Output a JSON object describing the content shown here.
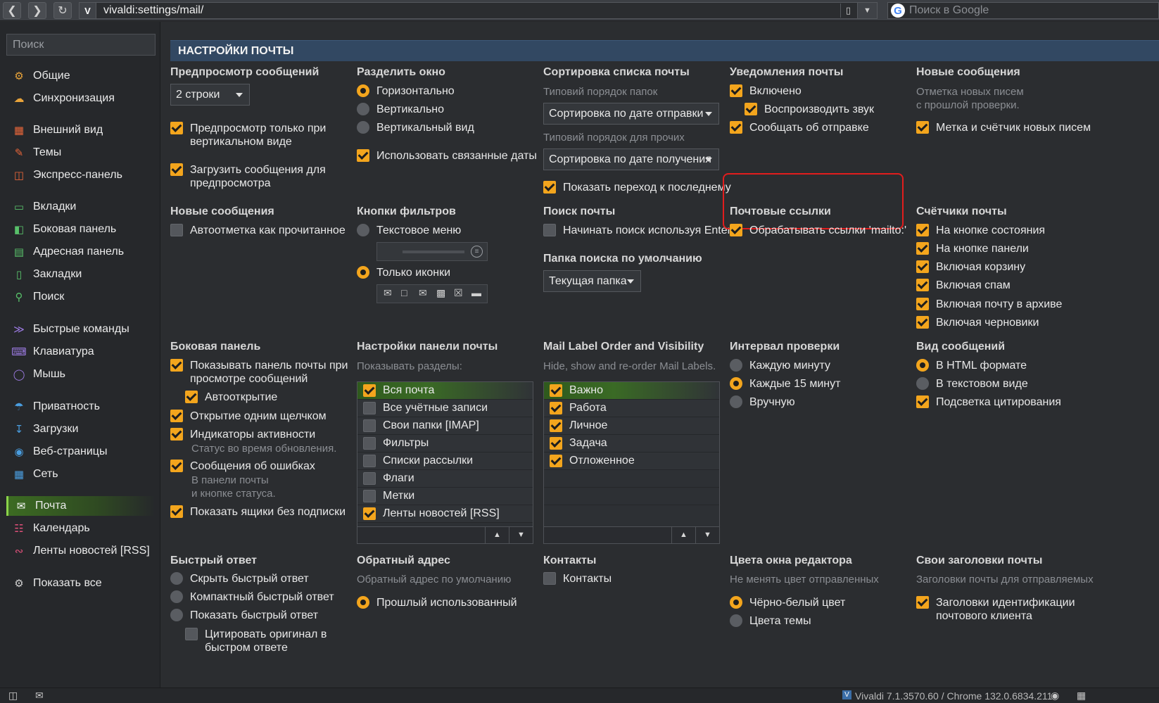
{
  "browser": {
    "url": "vivaldi:settings/mail/",
    "search_placeholder": "Поиск в Google",
    "vivaldi_logo": "V",
    "google_logo": "G"
  },
  "sidebar": {
    "search_placeholder": "Поиск",
    "items": [
      {
        "label": "Общие",
        "icon": "gear-cog-icon"
      },
      {
        "label": "Синхронизация",
        "icon": "cloud-icon"
      },
      {
        "label": "Внешний вид",
        "icon": "appearance-icon"
      },
      {
        "label": "Темы",
        "icon": "brush-icon"
      },
      {
        "label": "Экспресс-панель",
        "icon": "speed-dial-icon"
      },
      {
        "label": "Вкладки",
        "icon": "tabs-icon"
      },
      {
        "label": "Боковая панель",
        "icon": "panel-icon"
      },
      {
        "label": "Адресная панель",
        "icon": "address-bar-icon"
      },
      {
        "label": "Закладки",
        "icon": "bookmark-icon"
      },
      {
        "label": "Поиск",
        "icon": "search-icon"
      },
      {
        "label": "Быстрые команды",
        "icon": "quick-commands-icon"
      },
      {
        "label": "Клавиатура",
        "icon": "keyboard-icon"
      },
      {
        "label": "Мышь",
        "icon": "mouse-icon"
      },
      {
        "label": "Приватность",
        "icon": "shield-icon"
      },
      {
        "label": "Загрузки",
        "icon": "download-icon"
      },
      {
        "label": "Веб-страницы",
        "icon": "globe-icon"
      },
      {
        "label": "Сеть",
        "icon": "network-icon"
      },
      {
        "label": "Почта",
        "icon": "mail-icon",
        "active": true
      },
      {
        "label": "Календарь",
        "icon": "calendar-icon"
      },
      {
        "label": "Ленты новостей [RSS]",
        "icon": "rss-icon"
      },
      {
        "label": "Показать все",
        "icon": "gear-icon"
      }
    ]
  },
  "header": "НАСТРОЙКИ ПОЧТЫ",
  "preview": {
    "title": "Предпросмотр сообщений",
    "dropdown": "2 строки",
    "opt1": [
      "Предпросмотр только при",
      "вертикальном виде"
    ],
    "opt2": [
      "Загрузить сообщения для",
      "предпросмотра"
    ]
  },
  "split": {
    "title": "Разделить окно",
    "r1": "Горизонтально",
    "r2": "Вертикально",
    "r3": "Вертикальный вид",
    "c1": "Использовать связанные даты"
  },
  "sorting": {
    "title": "Сортировка списка почты",
    "sub1": "Типовий порядок папок",
    "dd1": "Сортировка по дате отправки",
    "sub2": "Типовий порядок для прочих",
    "dd2": "Сортировка по дате получения",
    "c1": "Показать переход к последнему"
  },
  "notify": {
    "title": "Уведомления почты",
    "c1": "Включено",
    "c2": "Воспроизводить звук",
    "c3": "Сообщать об отправке"
  },
  "newmsg": {
    "title": "Новые сообщения",
    "sub": [
      "Отметка новых писем",
      "с прошлой проверки."
    ],
    "c1": "Метка и счётчик новых писем"
  },
  "newmsg2": {
    "title": "Новые сообщения",
    "c1": "Автоотметка как прочитанное"
  },
  "filters": {
    "title": "Кнопки фильтров",
    "r1": "Текстовое меню",
    "r2": "Только иконки"
  },
  "mailsearch": {
    "title": "Поиск почты",
    "c1": "Начинать поиск используя Enter",
    "title2": "Папка поиска по умолчанию",
    "dd": "Текущая папка"
  },
  "links": {
    "title": "Почтовые ссылки",
    "c1": "Обрабатывать ссылки 'mailto:'"
  },
  "counters": {
    "title": "Счётчики почты",
    "items": [
      "На кнопке состояния",
      "На кнопке панели",
      "Включая корзину",
      "Включая спам",
      "Включая почту в архиве",
      "Включая черновики"
    ]
  },
  "sidepanel": {
    "title": "Боковая панель",
    "c1": [
      "Показывать панель почты при",
      "просмотре сообщений"
    ],
    "c2": "Автооткрытие",
    "c3": "Открытие одним щелчком",
    "c4": "Индикаторы активности",
    "c4sub": "Статус во время обновления.",
    "c5": "Сообщения об ошибках",
    "c5sub": [
      "В панели почты",
      "и кнопке статуса."
    ],
    "c6": "Показать ящики без подписки"
  },
  "panelset": {
    "title": "Настройки панели почты",
    "sub": "Показывать разделы:",
    "rows": [
      {
        "label": "Вся почта",
        "on": true
      },
      {
        "label": "Все учётные записи",
        "on": false
      },
      {
        "label": "Свои папки [IMAP]",
        "on": false
      },
      {
        "label": "Фильтры",
        "on": false
      },
      {
        "label": "Списки рассылки",
        "on": false
      },
      {
        "label": "Флаги",
        "on": false
      },
      {
        "label": "Метки",
        "on": false
      },
      {
        "label": "Ленты новостей [RSS]",
        "on": true
      }
    ]
  },
  "labels": {
    "title": "Mail Label Order and Visibility",
    "sub": "Hide, show and re-order Mail Labels.",
    "rows": [
      "Важно",
      "Работа",
      "Личное",
      "Задача",
      "Отложенное"
    ]
  },
  "interval": {
    "title": "Интервал проверки",
    "r1": "Каждую минуту",
    "r2": "Каждые 15 минут",
    "r3": "Вручную"
  },
  "view": {
    "title": "Вид сообщений",
    "r1": "В HTML формате",
    "r2": "В текстовом виде",
    "c1": "Подсветка цитирования"
  },
  "quick": {
    "title": "Быстрый ответ",
    "r1": "Скрыть быстрый ответ",
    "r2": "Компактный быстрый ответ",
    "r3": "Показать быстрый ответ",
    "c1": [
      "Цитировать оригинал в",
      "быстром ответе"
    ]
  },
  "reply": {
    "title": "Обратный адрес",
    "sub": "Обратный адрес по умолчанию",
    "r1": "Прошлый использованный"
  },
  "contacts": {
    "title": "Контакты",
    "c1": "Контакты"
  },
  "colors": {
    "title": "Цвета окна редактора",
    "sub": "Не менять цвет отправленных",
    "r1": "Чёрно-белый цвет",
    "r2": "Цвета темы"
  },
  "headers": {
    "title": "Свои заголовки почты",
    "sub": "Заголовки почты для отправляемых",
    "c1": [
      "Заголовки идентификации",
      "почтового клиента"
    ]
  },
  "status": {
    "version": "Vivaldi 7.1.3570.60 / Chrome 132.0.6834.211"
  },
  "colors_theme": {
    "accent": "#f3a51d",
    "header_bg": "#324862",
    "highlight": "#e11d1d",
    "active_green": "#3c6b22"
  }
}
